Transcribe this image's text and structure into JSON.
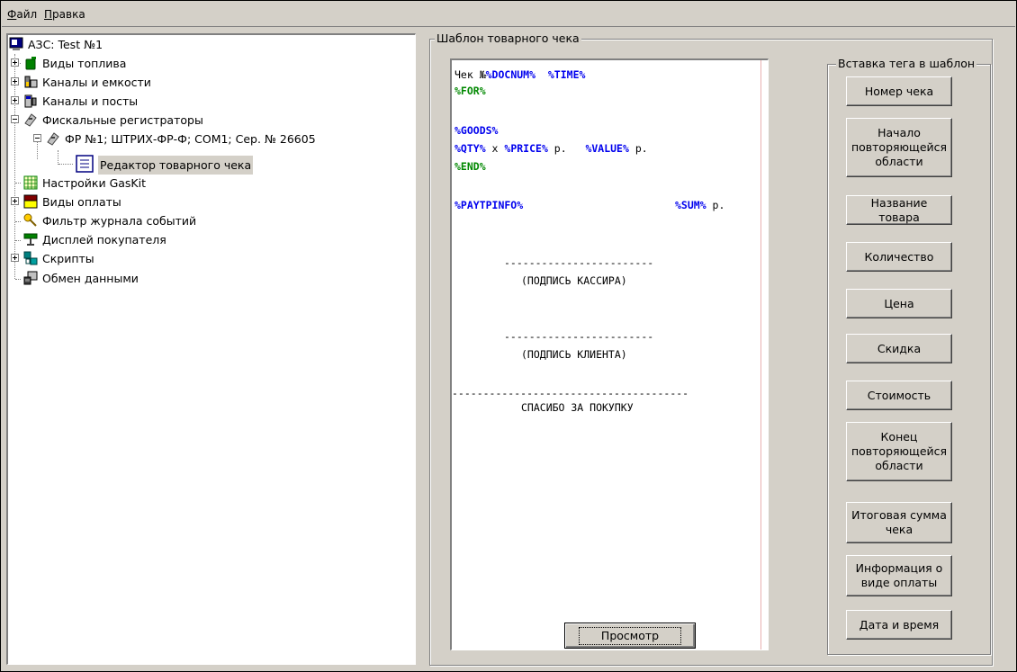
{
  "menu": {
    "file": {
      "accel": "Ф",
      "rest": "айл"
    },
    "edit": {
      "accel": "П",
      "rest": "равка"
    }
  },
  "tree": {
    "items": [
      {
        "label": "АЗС: Test №1",
        "icon": "computer-icon"
      },
      {
        "label": "Виды топлива",
        "icon": "fuel-can-icon"
      },
      {
        "label": "Каналы и емкости",
        "icon": "tank-icon"
      },
      {
        "label": "Каналы и посты",
        "icon": "pump-icon"
      },
      {
        "label": "Фискальные регистраторы",
        "icon": "register-icon"
      },
      {
        "label": "ФР №1; ШТРИХ-ФР-Ф; COM1; Сер. № 26605",
        "icon": "register-icon"
      },
      {
        "label": "Редактор товарного чека",
        "icon": "document-icon"
      },
      {
        "label": "Настройки GasKit",
        "icon": "grid-icon"
      },
      {
        "label": "Виды оплаты",
        "icon": "payment-icon"
      },
      {
        "label": "Фильтр журнала событий",
        "icon": "key-filter-icon"
      },
      {
        "label": "Дисплей покупателя",
        "icon": "display-icon"
      },
      {
        "label": "Скрипты",
        "icon": "scripts-icon"
      },
      {
        "label": "Обмен данными",
        "icon": "exchange-icon"
      }
    ]
  },
  "template_group": {
    "caption": "Шаблон товарного чека"
  },
  "tag_group": {
    "caption": "Вставка тега в шаблон"
  },
  "editor": {
    "line1_prefix": "Чек №",
    "tag_docnum": "%DOCNUM%",
    "tag_time": "%TIME%",
    "tag_for": "%FOR%",
    "tag_goods": "%GOODS%",
    "tag_qty": "%QTY%",
    "text_x": " x ",
    "tag_price": "%PRICE%",
    "text_rub1": " р.",
    "tag_value": "%VALUE%",
    "text_rub2": " р.",
    "tag_end": "%END%",
    "tag_paytpinfo": "%PAYTPINFO%",
    "tag_sum": "%SUM%",
    "text_rub3": " р.",
    "dashes_short": "------------------------",
    "cashier_sign": "(ПОДПИСЬ КАССИРА)",
    "client_sign": "(ПОДПИСЬ КЛИЕНТА)",
    "dashes_long": "--------------------------------------",
    "thanks": "СПАСИБО ЗА ПОКУПКУ"
  },
  "buttons": {
    "check_number": "Номер чека",
    "loop_start": "Начало повторяющейся области",
    "goods_name": "Название товара",
    "quantity": "Количество",
    "price": "Цена",
    "discount": "Скидка",
    "value": "Стоимость",
    "loop_end": "Конец повторяющейся области",
    "total_sum": "Итоговая сумма чека",
    "payment_info": "Информация о виде оплаты",
    "datetime": "Дата и время",
    "preview": "Просмотр"
  }
}
